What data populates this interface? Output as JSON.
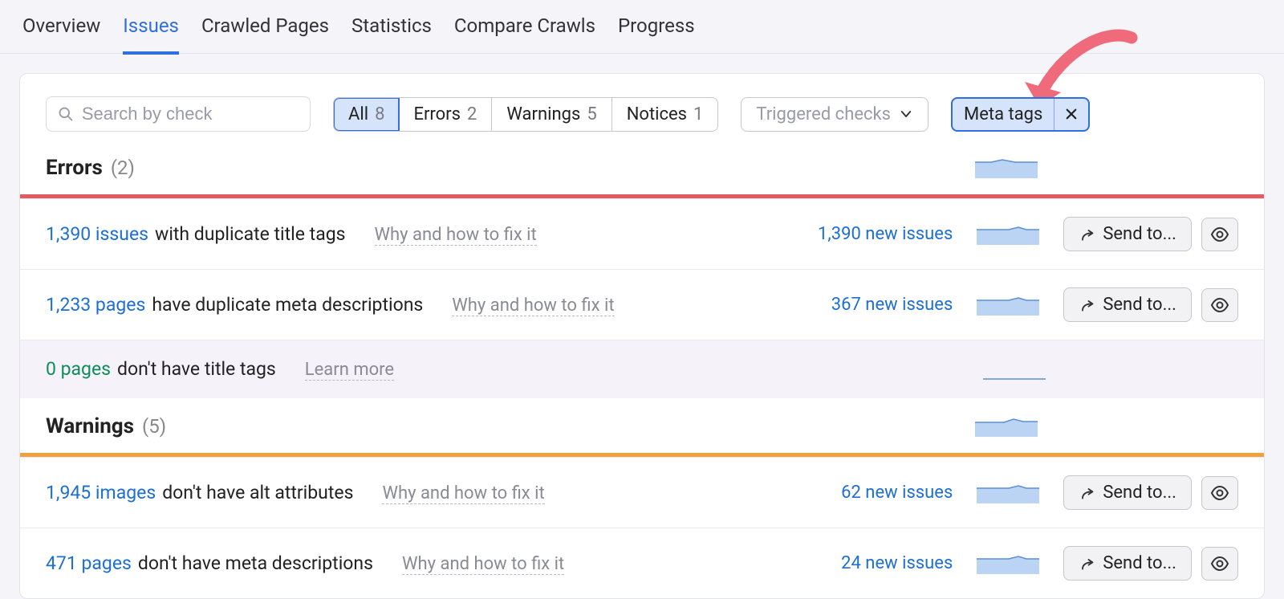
{
  "tabs": [
    {
      "label": "Overview",
      "active": false
    },
    {
      "label": "Issues",
      "active": true
    },
    {
      "label": "Crawled Pages",
      "active": false
    },
    {
      "label": "Statistics",
      "active": false
    },
    {
      "label": "Compare Crawls",
      "active": false
    },
    {
      "label": "Progress",
      "active": false
    }
  ],
  "toolbar": {
    "search_placeholder": "Search by check",
    "seg": [
      {
        "label": "All",
        "count": "8",
        "selected": true
      },
      {
        "label": "Errors",
        "count": "2",
        "selected": false
      },
      {
        "label": "Warnings",
        "count": "5",
        "selected": false
      },
      {
        "label": "Notices",
        "count": "1",
        "selected": false
      }
    ],
    "triggered_label": "Triggered checks",
    "chip_label": "Meta tags"
  },
  "sections": {
    "errors": {
      "title": "Errors",
      "count": "(2)"
    },
    "warnings": {
      "title": "Warnings",
      "count": "(5)"
    }
  },
  "rows": {
    "errors": [
      {
        "link": "1,390 issues",
        "rest": "with duplicate title tags",
        "hint": "Why and how to fix it",
        "new": "1,390 new issues",
        "send": "Send to..."
      },
      {
        "link": "1,233 pages",
        "rest": "have duplicate meta descriptions",
        "hint": "Why and how to fix it",
        "new": "367 new issues",
        "send": "Send to..."
      }
    ],
    "zero": {
      "link": "0 pages",
      "rest": "don't have title tags",
      "hint": "Learn more"
    },
    "warnings": [
      {
        "link": "1,945 images",
        "rest": "don't have alt attributes",
        "hint": "Why and how to fix it",
        "new": "62 new issues",
        "send": "Send to..."
      },
      {
        "link": "471 pages",
        "rest": "don't have meta descriptions",
        "hint": "Why and how to fix it",
        "new": "24 new issues",
        "send": "Send to..."
      }
    ]
  }
}
